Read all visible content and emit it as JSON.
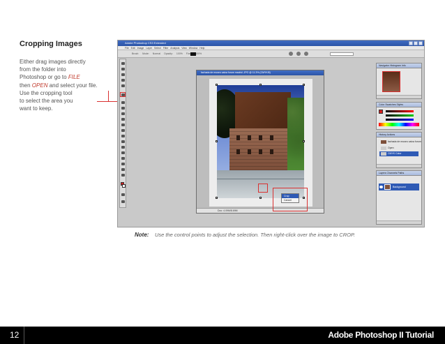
{
  "section": {
    "heading": "Cropping Images",
    "body_lines": [
      {
        "before": "Either drag images directly",
        "em": "",
        "after": ""
      },
      {
        "before": "from the folder into",
        "em": "",
        "after": ""
      },
      {
        "before": "Photoshop or go to ",
        "em": "FILE",
        "after": ""
      },
      {
        "before": "then ",
        "em": "OPEN",
        "after": " and select your file."
      },
      {
        "before": "Use the cropping tool",
        "em": "",
        "after": ""
      },
      {
        "before": "to select the area you",
        "em": "",
        "after": ""
      },
      {
        "before": "want to keep.",
        "em": "",
        "after": ""
      }
    ]
  },
  "screenshot": {
    "app_title": "Adobe Photoshop CS3 Extended",
    "menu": "File  Edit  Image  Layer  Select  Filter  Analysis  View  Window  Help",
    "options_bar": "Brush:  Mode: Normal  Opacity: 100%  Flow: 100%",
    "document_title": "fachada de museo caixa forum madrid .JPG @ 11.3% (CMYK/8)",
    "status": "Doc: 4.09M/8.69M",
    "context_menu": {
      "items": [
        "Crop",
        "Cancel"
      ],
      "selected_index": 0
    },
    "panels": {
      "navigator_tabs": "Navigator  Histogram  Info",
      "color_tabs": "Color  Swatches  Styles",
      "history_tabs": "History  Actions",
      "history_items": [
        "fachada de museo caixa forum",
        "Open",
        "CMYK Color"
      ],
      "history_selected": 2,
      "layers_tabs": "Layers  Channels  Paths",
      "layer_name": "Background"
    },
    "colors": {
      "highlight": "#d93030",
      "selection_blue": "#2e5ab5",
      "titlebar_blue": "#3f6bc2"
    }
  },
  "note": {
    "label": "Note:",
    "text": "Use the control points to adjust the selection.  Then right-click over the image to CROP."
  },
  "footer": {
    "page_number": "12",
    "title": "Adobe Photoshop II Tutorial"
  }
}
